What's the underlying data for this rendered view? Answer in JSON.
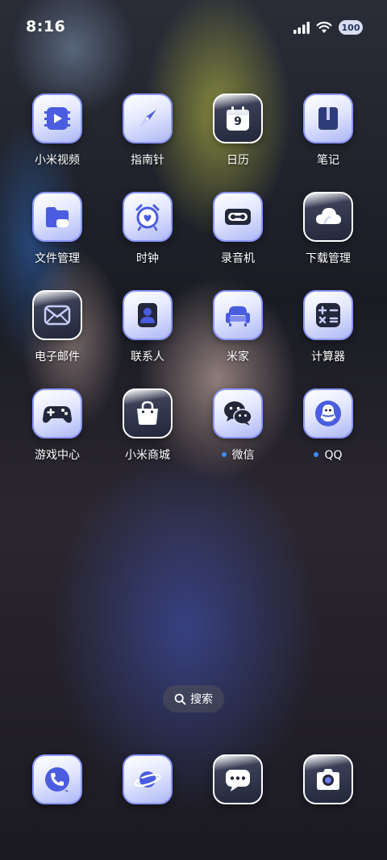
{
  "status_bar": {
    "time": "8:16",
    "battery": "100",
    "icons": [
      "signal-icon",
      "wifi-icon",
      "battery-icon"
    ]
  },
  "apps": [
    {
      "label": "小米视频",
      "icon": "video-play-icon",
      "style": "light"
    },
    {
      "label": "指南针",
      "icon": "compass-icon",
      "style": "light"
    },
    {
      "label": "日历",
      "icon": "calendar-icon",
      "style": "dark",
      "day": "9"
    },
    {
      "label": "笔记",
      "icon": "notebook-icon",
      "style": "light"
    },
    {
      "label": "文件管理",
      "icon": "folder-icon",
      "style": "light"
    },
    {
      "label": "时钟",
      "icon": "alarm-clock-icon",
      "style": "light"
    },
    {
      "label": "录音机",
      "icon": "cassette-recorder-icon",
      "style": "light"
    },
    {
      "label": "下载管理",
      "icon": "cloud-icon",
      "style": "dark"
    },
    {
      "label": "电子邮件",
      "icon": "envelope-icon",
      "style": "dark"
    },
    {
      "label": "联系人",
      "icon": "contact-card-icon",
      "style": "light"
    },
    {
      "label": "米家",
      "icon": "sofa-icon",
      "style": "light"
    },
    {
      "label": "计算器",
      "icon": "calculator-icon",
      "style": "light"
    },
    {
      "label": "游戏中心",
      "icon": "gamepad-icon",
      "style": "light"
    },
    {
      "label": "小米商城",
      "icon": "shopping-bag-icon",
      "style": "dark"
    },
    {
      "label": "微信",
      "icon": "wechat-icon",
      "style": "light",
      "badge_dot": true
    },
    {
      "label": "QQ",
      "icon": "qq-penguin-icon",
      "style": "light",
      "badge_dot": true
    }
  ],
  "search": {
    "label": "搜索",
    "icon": "search-icon"
  },
  "dock": [
    {
      "icon": "phone-icon",
      "style": "light"
    },
    {
      "icon": "planet-browser-icon",
      "style": "light"
    },
    {
      "icon": "message-icon",
      "style": "dark"
    },
    {
      "icon": "camera-icon",
      "style": "dark"
    }
  ],
  "colors": {
    "accent": "#8c97ff",
    "glyph": "#4a5ce0",
    "notification_dot": "#3d8bff"
  }
}
